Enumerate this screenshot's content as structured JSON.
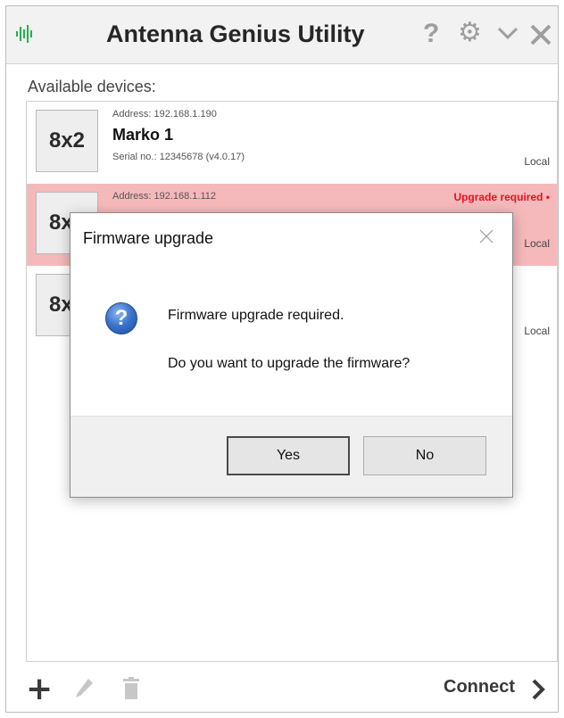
{
  "window": {
    "title": "Antenna Genius Utility",
    "icons": [
      "waveform-icon",
      "help-icon",
      "gear-icon",
      "chevron-down-icon",
      "close-icon"
    ],
    "help_symbol": "?"
  },
  "list": {
    "label": "Available devices:",
    "devices": [
      {
        "model": "8x2",
        "address": "Address: 192.168.1.190",
        "name": "Marko 1",
        "serial": "Serial no.: 12345678 (v4.0.17)",
        "location": "Local"
      },
      {
        "model": "8x2",
        "address": "Address: 192.168.1.112",
        "status": "Upgrade required •",
        "location": "Local"
      },
      {
        "model": "8x2",
        "location": "Local"
      }
    ]
  },
  "toolbar": {
    "add_symbol": "+",
    "connect_label": "Connect",
    "icons": [
      "add-icon",
      "edit-icon",
      "delete-icon",
      "chevron-right-icon"
    ]
  },
  "dialog": {
    "title": "Firmware upgrade",
    "icon_symbol": "?",
    "message_line1": "Firmware upgrade required.",
    "message_line2": "Do you want to upgrade the firmware?",
    "yes_label": "Yes",
    "no_label": "No"
  },
  "colors": {
    "selected_row": "#f5b9bb",
    "warning_text": "#e8121f",
    "logo": "#22b14c"
  }
}
